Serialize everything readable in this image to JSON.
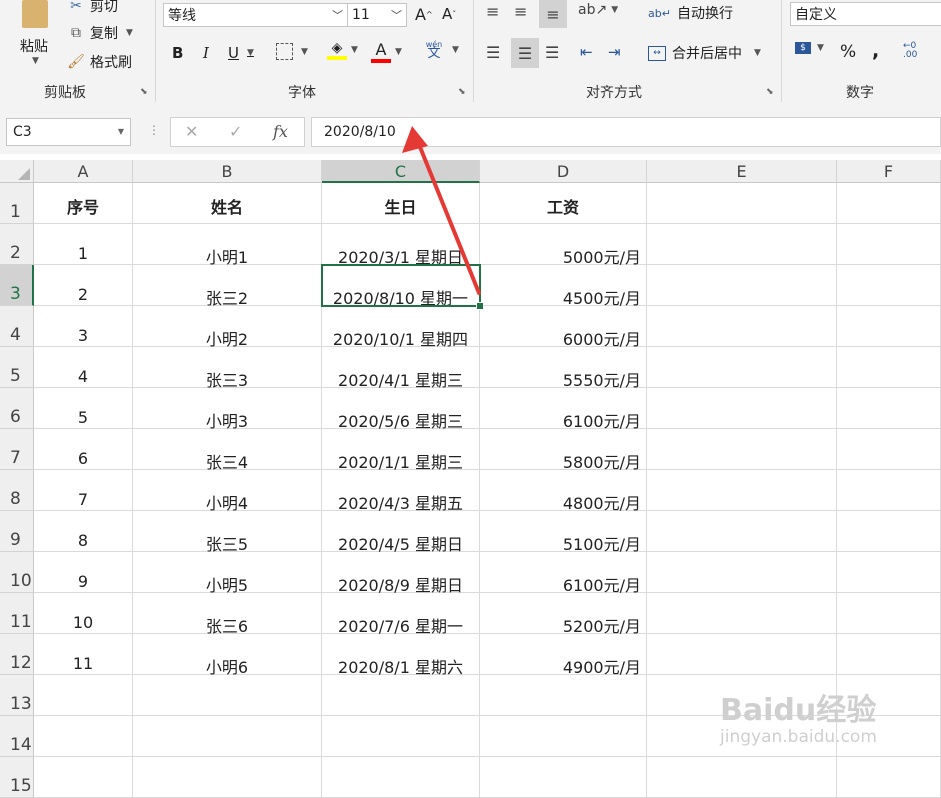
{
  "ribbon": {
    "clipboard": {
      "paste": "粘贴",
      "cut": "剪切",
      "copy": "复制",
      "format_painter": "格式刷",
      "group_label": "剪贴板"
    },
    "font": {
      "family": "等线",
      "size": "11",
      "bold": "B",
      "italic": "I",
      "underline": "U",
      "font_color_glyph": "A",
      "phonetic": "wén",
      "group_label": "字体"
    },
    "alignment": {
      "wrap_text": "自动换行",
      "merge_center": "合并后居中",
      "group_label": "对齐方式"
    },
    "number": {
      "format": "自定义",
      "percent": "%",
      "comma": ",",
      "group_label": "数字"
    }
  },
  "formula_bar": {
    "name_box": "C3",
    "cancel": "✕",
    "enter": "✓",
    "fx": "fx",
    "content": "2020/8/10"
  },
  "columns": [
    "A",
    "B",
    "C",
    "D",
    "E",
    "F"
  ],
  "selected_cell": "C3",
  "headers": {
    "a": "序号",
    "b": "姓名",
    "c": "生日",
    "d": "工资"
  },
  "rows": [
    {
      "no": "1",
      "name": "小明1",
      "birthday": "2020/3/1 星期日",
      "salary": "5000元/月"
    },
    {
      "no": "2",
      "name": "张三2",
      "birthday": "2020/8/10 星期一",
      "salary": "4500元/月"
    },
    {
      "no": "3",
      "name": "小明2",
      "birthday": "2020/10/1 星期四",
      "salary": "6000元/月"
    },
    {
      "no": "4",
      "name": "张三3",
      "birthday": "2020/4/1 星期三",
      "salary": "5550元/月"
    },
    {
      "no": "5",
      "name": "小明3",
      "birthday": "2020/5/6 星期三",
      "salary": "6100元/月"
    },
    {
      "no": "6",
      "name": "张三4",
      "birthday": "2020/1/1 星期三",
      "salary": "5800元/月"
    },
    {
      "no": "7",
      "name": "小明4",
      "birthday": "2020/4/3 星期五",
      "salary": "4800元/月"
    },
    {
      "no": "8",
      "name": "张三5",
      "birthday": "2020/4/5 星期日",
      "salary": "5100元/月"
    },
    {
      "no": "9",
      "name": "小明5",
      "birthday": "2020/8/9 星期日",
      "salary": "6100元/月"
    },
    {
      "no": "10",
      "name": "张三6",
      "birthday": "2020/7/6 星期一",
      "salary": "5200元/月"
    },
    {
      "no": "11",
      "name": "小明6",
      "birthday": "2020/8/1 星期六",
      "salary": "4900元/月"
    }
  ],
  "row_numbers": [
    "1",
    "2",
    "3",
    "4",
    "5",
    "6",
    "7",
    "8",
    "9",
    "10",
    "11",
    "12",
    "13",
    "14",
    "15"
  ],
  "watermark": {
    "brand": "Baidu经验",
    "url": "jingyan.baidu.com"
  },
  "colors": {
    "accent_green": "#217346",
    "arrow_red": "#e53935",
    "header_bg": "#efefef"
  }
}
